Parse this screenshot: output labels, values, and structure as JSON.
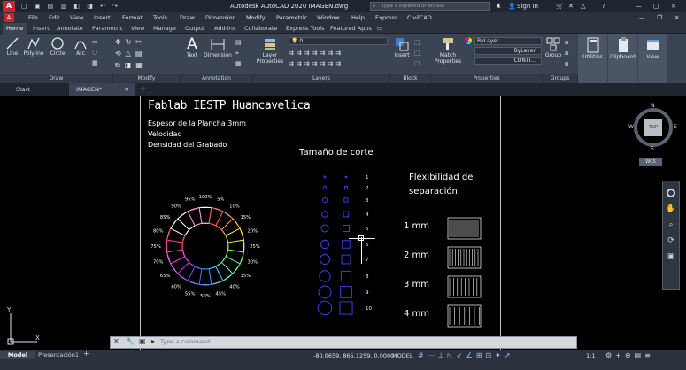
{
  "title": "Autodesk AutoCAD 2020   IMAGEN.dwg",
  "search_placeholder": "Type a keyword or phrase",
  "sign_in": "Sign In",
  "menu": [
    "File",
    "Edit",
    "View",
    "Insert",
    "Format",
    "Tools",
    "Draw",
    "Dimension",
    "Modify",
    "Parametric",
    "Window",
    "Help",
    "Express",
    "CivilCAD"
  ],
  "ribbon_tabs": [
    "Home",
    "Insert",
    "Annotate",
    "Parametric",
    "View",
    "Manage",
    "Output",
    "Add-ins",
    "Collaborate",
    "Express Tools",
    "Featured Apps"
  ],
  "ribbon": {
    "draw_tools": [
      "Line",
      "Polyline",
      "Circle",
      "Arc"
    ],
    "text_label": "Text",
    "dimension_label": "Dimension",
    "layer_properties": "Layer Properties",
    "layer_value": "0",
    "insert_label": "Insert",
    "match_properties": "Match Properties",
    "bylayer": "ByLayer",
    "bylayer2": "ByLayer",
    "continuous": "CONTI...",
    "group_label": "Group",
    "utilities": "Utilities",
    "clipboard": "Clipboard",
    "view": "View",
    "panels": [
      "Draw",
      "Modify",
      "Annotation",
      "Layers",
      "Block",
      "Properties",
      "Groups"
    ]
  },
  "file_tabs": [
    "Start",
    "IMAGEN*"
  ],
  "drawing": {
    "heading": "Fablab IESTP Huancavelica",
    "lines": [
      "Espesor de la Plancha 3mm",
      "Velocidad",
      "Densidad del Grabado"
    ],
    "cut_size_title": "Tamaño de corte",
    "flex_title_1": "Flexibilidad de",
    "flex_title_2": "separación:",
    "percents": [
      "100%",
      "5%",
      "10%",
      "15%",
      "20%",
      "25%",
      "30%",
      "35%",
      "40%",
      "45%",
      "50%",
      "55%",
      "60%",
      "65%",
      "70%",
      "75%",
      "80%",
      "85%",
      "90%",
      "95%"
    ],
    "sizes": [
      "1",
      "2",
      "3",
      "4",
      "5",
      "6",
      "7",
      "8",
      "9",
      "10"
    ],
    "flex_labels": [
      "1 mm",
      "2 mm",
      "3 mm",
      "4 mm"
    ]
  },
  "viewcube": {
    "top": "TOP",
    "n": "N",
    "s": "S",
    "w": "W",
    "e": "E",
    "wcs": "WCS"
  },
  "ucs": {
    "x": "X",
    "y": "Y"
  },
  "command_placeholder": "Type a command",
  "layout_tabs": [
    "Model",
    "Presentación1"
  ],
  "coordinates": "-80.0659, 865.1259, 0.0000",
  "model_label": "MODEL",
  "scale": "1:1"
}
